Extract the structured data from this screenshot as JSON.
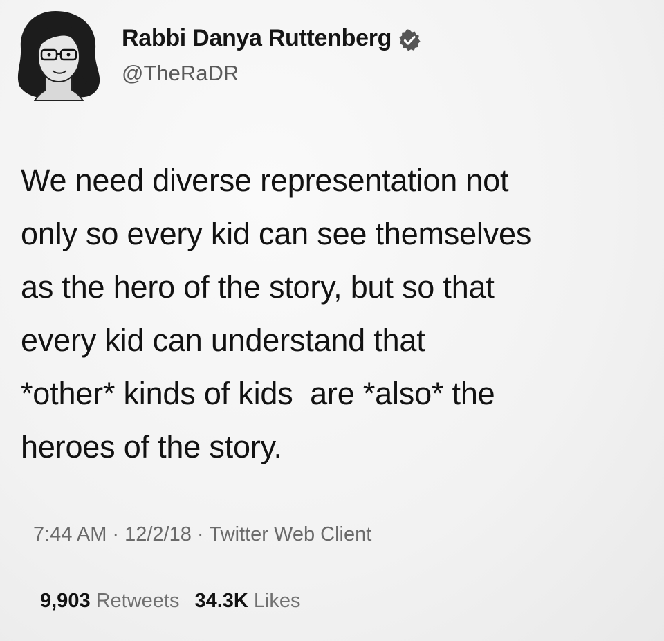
{
  "author": {
    "name": "Rabbi Danya Ruttenberg",
    "handle": "@TheRaDR",
    "verified": true,
    "avatar_icon": "avatar-cartoon-woman-glasses"
  },
  "tweet": {
    "text_lines": [
      "We need diverse representation not",
      "only so every kid can see themselves",
      "as the hero of the story, but so that",
      "every kid can understand that",
      "*other* kinds of kids  are *also* the",
      "heroes of the story."
    ]
  },
  "meta": {
    "time": "7:44 AM",
    "date": "12/2/18",
    "client": "Twitter Web Client",
    "separator": "·"
  },
  "stats": {
    "retweets_count": "9,903",
    "retweets_label": "Retweets",
    "likes_count": "34.3K",
    "likes_label": "Likes"
  },
  "colors": {
    "background": "#f4f4f4",
    "text": "#121212",
    "secondary": "#6a6a6a",
    "badge": "#555555"
  }
}
